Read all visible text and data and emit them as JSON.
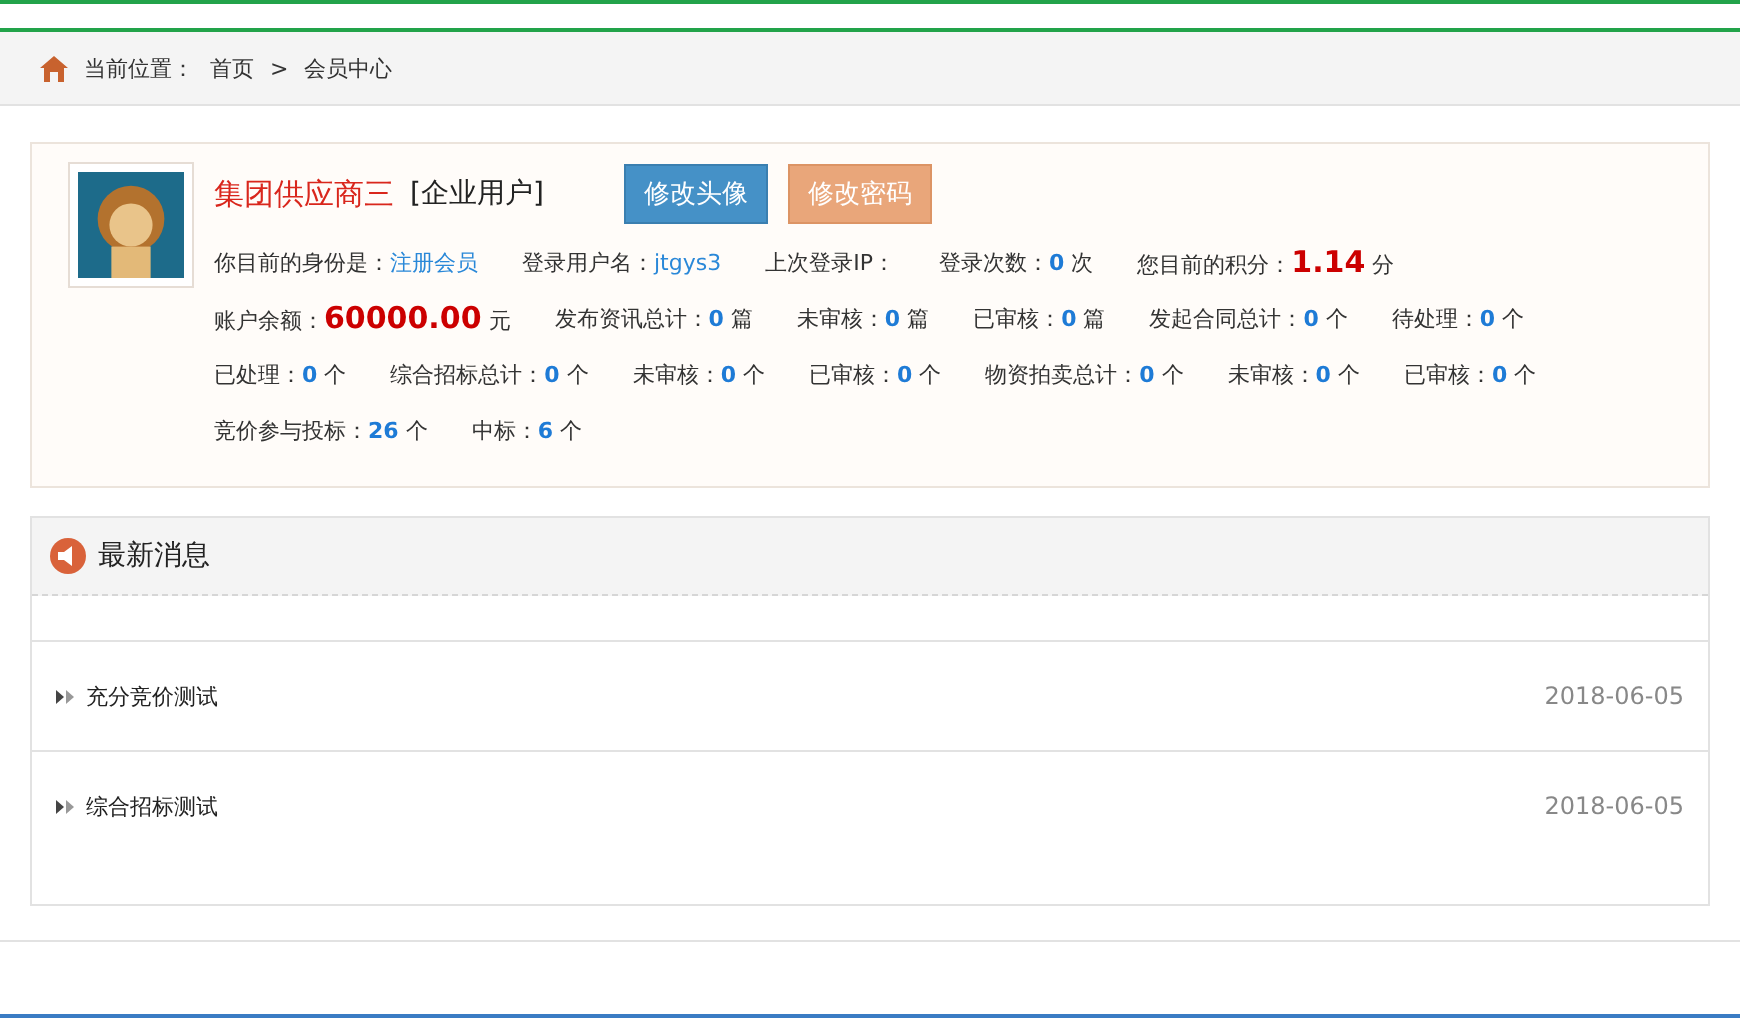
{
  "breadcrumb": {
    "label": "当前位置：",
    "items": [
      {
        "text": "首页"
      },
      {
        "text": "会员中心"
      }
    ],
    "separator": ">"
  },
  "member": {
    "name": "集团供应商三",
    "type": "[企业用户]",
    "buttons": [
      {
        "label": "修改头像",
        "kind": "primary"
      },
      {
        "label": "修改密码",
        "kind": "secondary"
      }
    ],
    "stats": [
      [
        {
          "label": "你目前的身份是：",
          "value": "注册会员",
          "kind": "link"
        },
        {
          "label": "登录用户名：",
          "value": "jtgys3",
          "kind": "link"
        },
        {
          "label": "上次登录IP：",
          "kind": "plain"
        },
        {
          "label": "登录次数：",
          "value": "0",
          "unit": "次",
          "kind": "number"
        },
        {
          "label": "您目前的积分：",
          "value": "1.14",
          "unit": "分",
          "kind": "big"
        }
      ],
      [
        {
          "label": "账户余额：",
          "value": "60000.00",
          "unit": "元",
          "kind": "big"
        },
        {
          "label": "发布资讯总计：",
          "value": "0",
          "unit": "篇",
          "kind": "number"
        },
        {
          "label": "未审核：",
          "value": "0",
          "unit": "篇",
          "kind": "number"
        },
        {
          "label": "已审核：",
          "value": "0",
          "unit": "篇",
          "kind": "number"
        },
        {
          "label": "发起合同总计：",
          "value": "0",
          "unit": "个",
          "kind": "number"
        },
        {
          "label": "待处理：",
          "value": "0",
          "unit": "个",
          "kind": "number"
        }
      ],
      [
        {
          "label": "已处理：",
          "value": "0",
          "unit": "个",
          "kind": "number"
        },
        {
          "label": "综合招标总计：",
          "value": "0",
          "unit": "个",
          "kind": "number"
        },
        {
          "label": "未审核：",
          "value": "0",
          "unit": "个",
          "kind": "number"
        },
        {
          "label": "已审核：",
          "value": "0",
          "unit": "个",
          "kind": "number"
        },
        {
          "label": "物资拍卖总计：",
          "value": "0",
          "unit": "个",
          "kind": "number"
        },
        {
          "label": "未审核：",
          "value": "0",
          "unit": "个",
          "kind": "number"
        },
        {
          "label": "已审核：",
          "value": "0",
          "unit": "个",
          "kind": "number"
        }
      ],
      [
        {
          "label": "竞价参与投标：",
          "value": "26",
          "unit": "个",
          "kind": "number"
        },
        {
          "label": "中标：",
          "value": "6",
          "unit": "个",
          "kind": "number"
        }
      ]
    ]
  },
  "news": {
    "title": "最新消息",
    "items": [
      {
        "title": "充分竞价测试",
        "date": "2018-06-05"
      },
      {
        "title": "综合招标测试",
        "date": "2018-06-05"
      }
    ]
  }
}
